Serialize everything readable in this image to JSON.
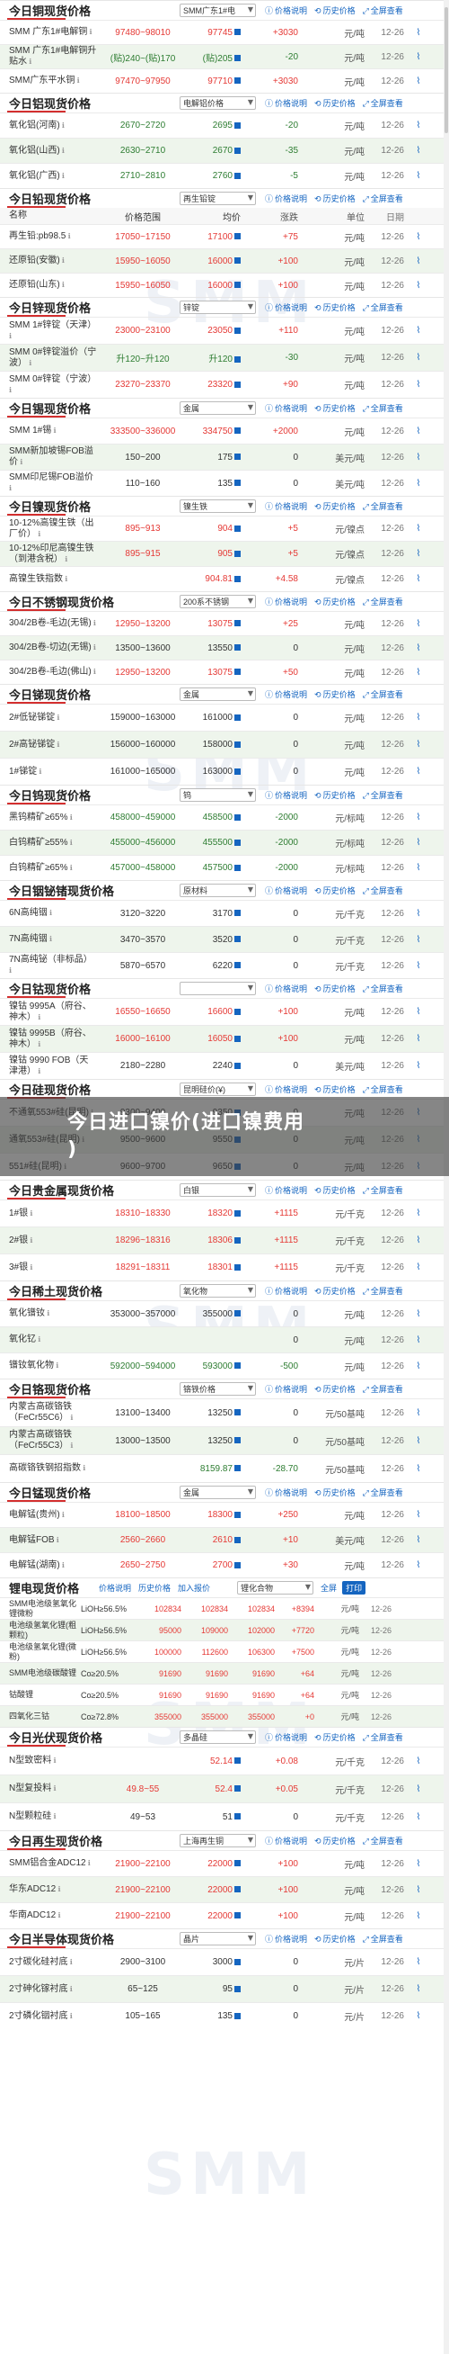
{
  "overlay": {
    "line1": "今日进口镍价(进口镍费用",
    "line2": ")"
  },
  "watermark": "SMM",
  "sections": [
    {
      "key": "copper",
      "title": "今日铜现货价格",
      "select": "SMM广东1#电",
      "links": [
        "价格说明",
        "历史价格",
        "全屏查看"
      ],
      "dateHdr": "",
      "rows": [
        {
          "name": "SMM 广东1#电解铜",
          "range": "97480~98010",
          "avg": "97745",
          "chg": "+3030",
          "cls": "red",
          "unit": "元/吨",
          "date": "12-26"
        },
        {
          "name": "SMM 广东1#电解铜升贴水",
          "range": "(贴)240~(贴)170",
          "avg": "(贴)205",
          "chg": "-20",
          "cls": "green",
          "unit": "元/吨",
          "date": "12-26"
        },
        {
          "name": "SMM广东平水铜",
          "range": "97470~97950",
          "avg": "97710",
          "chg": "+3030",
          "cls": "red",
          "unit": "元/吨",
          "date": "12-26"
        }
      ]
    },
    {
      "key": "alu",
      "title": "今日铝现货价格",
      "select": "电解铝价格",
      "links": [
        "价格说明",
        "历史价格",
        "全屏查看"
      ],
      "rows": [
        {
          "name": "氧化铝(河南)",
          "range": "2670~2720",
          "avg": "2695",
          "chg": "-20",
          "cls": "green",
          "unit": "元/吨",
          "date": "12-26"
        },
        {
          "name": "氧化铝(山西)",
          "range": "2630~2710",
          "avg": "2670",
          "chg": "-35",
          "cls": "green",
          "unit": "元/吨",
          "date": "12-26"
        },
        {
          "name": "氧化铝(广西)",
          "range": "2710~2810",
          "avg": "2760",
          "chg": "-5",
          "cls": "green",
          "unit": "元/吨",
          "date": "12-26"
        }
      ]
    },
    {
      "key": "lead",
      "title": "今日铅现货价格",
      "select": "再生铅锭",
      "links": [
        "价格说明",
        "历史价格",
        "全屏查看"
      ],
      "cols": [
        "名称",
        "价格范围",
        "均价",
        "涨跌",
        "单位",
        "日期"
      ],
      "rows": [
        {
          "name": "再生铅:pb98.5",
          "range": "17050~17150",
          "avg": "17100",
          "chg": "+75",
          "cls": "red",
          "unit": "元/吨",
          "date": "12-26"
        },
        {
          "name": "还原铅(安徽)",
          "range": "15950~16050",
          "avg": "16000",
          "chg": "+100",
          "cls": "red",
          "unit": "元/吨",
          "date": "12-26"
        },
        {
          "name": "还原铅(山东)",
          "range": "15950~16050",
          "avg": "16000",
          "chg": "+100",
          "cls": "red",
          "unit": "元/吨",
          "date": "12-26"
        }
      ]
    },
    {
      "key": "zinc",
      "title": "今日锌现货价格",
      "select": "锌锭",
      "links": [
        "价格说明",
        "历史价格",
        "全屏查看"
      ],
      "rows": [
        {
          "name": "SMM 1#锌锭（天津）",
          "range": "23000~23100",
          "avg": "23050",
          "chg": "+110",
          "cls": "red",
          "unit": "元/吨",
          "date": "12-26"
        },
        {
          "name": "SMM 0#锌锭溢价（宁波）",
          "range": "升120~升120",
          "avg": "升120",
          "chg": "-30",
          "cls": "green",
          "unit": "元/吨",
          "date": "12-26"
        },
        {
          "name": "SMM 0#锌锭（宁波）",
          "range": "23270~23370",
          "avg": "23320",
          "chg": "+90",
          "cls": "red",
          "unit": "元/吨",
          "date": "12-26"
        }
      ]
    },
    {
      "key": "tin",
      "title": "今日锡现货价格",
      "select": "金属",
      "links": [
        "价格说明",
        "历史价格",
        "全屏查看"
      ],
      "rows": [
        {
          "name": "SMM 1#锡",
          "range": "333500~336000",
          "avg": "334750",
          "chg": "+2000",
          "cls": "red",
          "unit": "元/吨",
          "date": "12-26"
        },
        {
          "name": "SMM新加坡锡FOB溢价",
          "range": "150~200",
          "avg": "175",
          "chg": "0",
          "cls": "",
          "unit": "美元/吨",
          "date": "12-26"
        },
        {
          "name": "SMM印尼锡FOB溢价",
          "range": "110~160",
          "avg": "135",
          "chg": "0",
          "cls": "",
          "unit": "美元/吨",
          "date": "12-26"
        }
      ]
    },
    {
      "key": "iron",
      "title": "今日镍现货价格",
      "select": "镍生铁",
      "links": [
        "价格说明",
        "历史价格",
        "全屏查看"
      ],
      "rows": [
        {
          "name": "10-12%高镍生铁（出厂价）",
          "range": "895~913",
          "avg": "904",
          "chg": "+5",
          "cls": "red",
          "unit": "元/镍点",
          "date": "12-26"
        },
        {
          "name": "10-12%印尼高镍生铁（到港含税）",
          "range": "895~915",
          "avg": "905",
          "chg": "+5",
          "cls": "red",
          "unit": "元/镍点",
          "date": "12-26"
        },
        {
          "name": "高镍生铁指数",
          "range": "",
          "avg": "904.81",
          "chg": "+4.58",
          "cls": "red",
          "unit": "元/镍点",
          "date": "12-26"
        }
      ]
    },
    {
      "key": "ss",
      "title": "今日不锈钢现货价格",
      "select": "200系不锈钢",
      "links": [
        "价格说明",
        "历史价格",
        "全屏查看"
      ],
      "rows": [
        {
          "name": "304/2B卷-毛边(无锡)",
          "range": "12950~13200",
          "avg": "13075",
          "chg": "+25",
          "cls": "red",
          "unit": "元/吨",
          "date": "12-26"
        },
        {
          "name": "304/2B卷-切边(无锡)",
          "range": "13500~13600",
          "avg": "13550",
          "chg": "0",
          "cls": "",
          "unit": "元/吨",
          "date": "12-26"
        },
        {
          "name": "304/2B卷-毛边(佛山)",
          "range": "12950~13200",
          "avg": "13075",
          "chg": "+50",
          "cls": "red",
          "unit": "元/吨",
          "date": "12-26"
        }
      ]
    },
    {
      "key": "anti",
      "title": "今日锑现货价格",
      "select": "金属",
      "links": [
        "价格说明",
        "历史价格",
        "全屏查看"
      ],
      "rows": [
        {
          "name": "2#低铋锑锭",
          "range": "159000~163000",
          "avg": "161000",
          "chg": "0",
          "cls": "",
          "unit": "元/吨",
          "date": "12-26"
        },
        {
          "name": "2#高铋锑锭",
          "range": "156000~160000",
          "avg": "158000",
          "chg": "0",
          "cls": "",
          "unit": "元/吨",
          "date": "12-26"
        },
        {
          "name": "1#锑锭",
          "range": "161000~165000",
          "avg": "163000",
          "chg": "0",
          "cls": "",
          "unit": "元/吨",
          "date": "12-26"
        }
      ]
    },
    {
      "key": "w",
      "title": "今日钨现货价格",
      "select": "钨",
      "links": [
        "价格说明",
        "历史价格",
        "全屏查看"
      ],
      "rows": [
        {
          "name": "黑钨精矿≥65%",
          "range": "458000~459000",
          "avg": "458500",
          "chg": "-2000",
          "cls": "green",
          "unit": "元/标吨",
          "date": "12-26"
        },
        {
          "name": "白钨精矿≥55%",
          "range": "455000~456000",
          "avg": "455500",
          "chg": "-2000",
          "cls": "green",
          "unit": "元/标吨",
          "date": "12-26"
        },
        {
          "name": "白钨精矿≥65%",
          "range": "457000~458000",
          "avg": "457500",
          "chg": "-2000",
          "cls": "green",
          "unit": "元/标吨",
          "date": "12-26"
        }
      ]
    },
    {
      "key": "in",
      "title": "今日铟铋锗现货价格",
      "select": "原材料",
      "links": [
        "价格说明",
        "历史价格",
        "全屏查看"
      ],
      "rows": [
        {
          "name": "6N高纯铟",
          "range": "3120~3220",
          "avg": "3170",
          "chg": "0",
          "cls": "",
          "unit": "元/千克",
          "date": "12-26"
        },
        {
          "name": "7N高纯铟",
          "range": "3470~3570",
          "avg": "3520",
          "chg": "0",
          "cls": "",
          "unit": "元/千克",
          "date": "12-26"
        },
        {
          "name": "7N高纯铋（非标品）",
          "range": "5870~6570",
          "avg": "6220",
          "chg": "0",
          "cls": "",
          "unit": "元/千克",
          "date": "12-26"
        }
      ]
    },
    {
      "key": "co",
      "title": "今日钴现货价格",
      "select": "",
      "links": [
        "价格说明",
        "历史价格",
        "全屏查看"
      ],
      "rows": [
        {
          "name": "镍钴 9995A（府谷、神木）",
          "range": "16550~16650",
          "avg": "16600",
          "chg": "+100",
          "cls": "red",
          "unit": "元/吨",
          "date": "12-26"
        },
        {
          "name": "镍钴 9995B（府谷、神木）",
          "range": "16000~16100",
          "avg": "16050",
          "chg": "+100",
          "cls": "red",
          "unit": "元/吨",
          "date": "12-26"
        },
        {
          "name": "镍钴 9990 FOB（天津港）",
          "range": "2180~2280",
          "avg": "2240",
          "chg": "0",
          "cls": "",
          "unit": "美元/吨",
          "date": "12-26"
        }
      ]
    },
    {
      "key": "si",
      "title": "今日硅现货价格",
      "select": "昆明硅价(¥)",
      "links": [
        "价格说明",
        "历史价格",
        "全屏查看"
      ],
      "rows": [
        {
          "name": "不通氧553#硅(昆明)",
          "range": "9300~9400",
          "avg": "9350",
          "chg": "0",
          "cls": "",
          "unit": "元/吨",
          "date": "12-26"
        },
        {
          "name": "通氧553#硅(昆明)",
          "range": "9500~9600",
          "avg": "9550",
          "chg": "0",
          "cls": "",
          "unit": "元/吨",
          "date": "12-26"
        },
        {
          "name": "551#硅(昆明)",
          "range": "9600~9700",
          "avg": "9650",
          "chg": "0",
          "cls": "",
          "unit": "元/吨",
          "date": "12-26"
        }
      ]
    },
    {
      "key": "ag",
      "title": "今日贵金属现货价格",
      "select": "白银",
      "links": [
        "价格说明",
        "历史价格",
        "全屏查看"
      ],
      "rows": [
        {
          "name": "1#银",
          "range": "18310~18330",
          "avg": "18320",
          "chg": "+1115",
          "cls": "red",
          "unit": "元/千克",
          "date": "12-26"
        },
        {
          "name": "2#银",
          "range": "18296~18316",
          "avg": "18306",
          "chg": "+1115",
          "cls": "red",
          "unit": "元/千克",
          "date": "12-26"
        },
        {
          "name": "3#银",
          "range": "18291~18311",
          "avg": "18301",
          "chg": "+1115",
          "cls": "red",
          "unit": "元/千克",
          "date": "12-26"
        }
      ]
    },
    {
      "key": "re",
      "title": "今日稀土现货价格",
      "select": "氧化物",
      "links": [
        "价格说明",
        "历史价格",
        "全屏查看"
      ],
      "rows": [
        {
          "name": "氧化镨钕",
          "range": "353000~357000",
          "avg": "355000",
          "chg": "0",
          "cls": "",
          "unit": "元/吨",
          "date": "12-26"
        },
        {
          "name": "氧化钇",
          "range": "",
          "avg": "",
          "chg": "0",
          "cls": "",
          "unit": "元/吨",
          "date": "12-26"
        },
        {
          "name": "镨钕氧化物",
          "range": "592000~594000",
          "avg": "593000",
          "chg": "-500",
          "cls": "green",
          "unit": "元/吨",
          "date": "12-26"
        }
      ]
    },
    {
      "key": "fe",
      "title": "今日铬现货价格",
      "select": "铬铁价格",
      "links": [
        "价格说明",
        "历史价格",
        "全屏查看"
      ],
      "rows": [
        {
          "name": "内蒙古高碳铬铁（FeCr55C6）",
          "range": "13100~13400",
          "avg": "13250",
          "chg": "0",
          "cls": "",
          "unit": "元/50基吨",
          "date": "12-26"
        },
        {
          "name": "内蒙古高碳铬铁（FeCr55C3）",
          "range": "13000~13500",
          "avg": "13250",
          "chg": "0",
          "cls": "",
          "unit": "元/50基吨",
          "date": "12-26"
        },
        {
          "name": "高碳铬铁钢招指数",
          "range": "",
          "avg": "8159.87",
          "chg": "-28.70",
          "cls": "green",
          "unit": "元/50基吨",
          "date": "12-26"
        }
      ]
    },
    {
      "key": "mn",
      "title": "今日锰现货价格",
      "select": "金属",
      "links": [
        "价格说明",
        "历史价格",
        "全屏查看"
      ],
      "rows": [
        {
          "name": "电解锰(贵州)",
          "range": "18100~18500",
          "avg": "18300",
          "chg": "+250",
          "cls": "red",
          "unit": "元/吨",
          "date": "12-26"
        },
        {
          "name": "电解锰FOB",
          "range": "2560~2660",
          "avg": "2610",
          "chg": "+10",
          "cls": "red",
          "unit": "美元/吨",
          "date": "12-26"
        },
        {
          "name": "电解锰(湖南)",
          "range": "2650~2750",
          "avg": "2700",
          "chg": "+30",
          "cls": "red",
          "unit": "元/吨",
          "date": "12-26"
        }
      ]
    }
  ],
  "lithium": {
    "title": "锂电现货价格",
    "links": [
      "价格说明",
      "历史价格",
      "加入报价"
    ],
    "select": "锂化合物",
    "btn": "全屏",
    "print": "打印",
    "rows": [
      {
        "name": "SMM电池级氢氧化锂微粉",
        "spec": "LiOH≥56.5%",
        "v1": "102834",
        "v2": "102834",
        "v3": "102834",
        "chg": "+8394",
        "unit": "元/吨",
        "date": "12-26"
      },
      {
        "name": "电池级氢氧化锂(粗颗粒)",
        "spec": "LiOH≥56.5%",
        "v1": "95000",
        "v2": "109000",
        "v3": "102000",
        "chg": "+7720",
        "unit": "元/吨",
        "date": "12-26"
      },
      {
        "name": "电池级氢氧化锂(微粉)",
        "spec": "LiOH≥56.5%",
        "v1": "100000",
        "v2": "112600",
        "v3": "106300",
        "chg": "+7500",
        "unit": "元/吨",
        "date": "12-26"
      },
      {
        "name": "SMM电池级碳酸锂",
        "spec": "Co≥20.5%",
        "v1": "91690",
        "v2": "91690",
        "v3": "91690",
        "chg": "+64",
        "unit": "元/吨",
        "date": "12-26"
      },
      {
        "name": "钴酸锂",
        "spec": "Co≥20.5%",
        "v1": "91690",
        "v2": "91690",
        "v3": "91690",
        "chg": "+64",
        "unit": "元/吨",
        "date": "12-26"
      },
      {
        "name": "四氧化三钴",
        "spec": "Co≥72.8%",
        "v1": "355000",
        "v2": "355000",
        "v3": "355000",
        "chg": "+0",
        "unit": "元/吨",
        "date": "12-26"
      }
    ]
  },
  "tail": [
    {
      "key": "pv",
      "title": "今日光伏现货价格",
      "select": "多晶硅",
      "links": [
        "价格说明",
        "历史价格",
        "全屏查看"
      ],
      "rows": [
        {
          "name": "N型致密料",
          "range": "",
          "avg": "52.14",
          "chg": "+0.08",
          "cls": "red",
          "unit": "元/千克",
          "date": "12-26"
        },
        {
          "name": "N型复投料",
          "range": "49.8~55",
          "avg": "52.4",
          "chg": "+0.05",
          "cls": "red",
          "unit": "元/千克",
          "date": "12-26"
        },
        {
          "name": "N型颗粒硅",
          "range": "49~53",
          "avg": "51",
          "chg": "0",
          "cls": "",
          "unit": "元/千克",
          "date": "12-26"
        }
      ]
    },
    {
      "key": "rc",
      "title": "今日再生现货价格",
      "select": "上海再生铜",
      "links": [
        "价格说明",
        "历史价格",
        "全屏查看"
      ],
      "rows": [
        {
          "name": "SMM铝合金ADC12",
          "range": "21900~22100",
          "avg": "22000",
          "chg": "+100",
          "cls": "red",
          "unit": "元/吨",
          "date": "12-26"
        },
        {
          "name": "华东ADC12",
          "range": "21900~22100",
          "avg": "22000",
          "chg": "+100",
          "cls": "red",
          "unit": "元/吨",
          "date": "12-26"
        },
        {
          "name": "华南ADC12",
          "range": "21900~22100",
          "avg": "22000",
          "chg": "+100",
          "cls": "red",
          "unit": "元/吨",
          "date": "12-26"
        }
      ]
    },
    {
      "key": "semi",
      "title": "今日半导体现货价格",
      "select": "晶片",
      "links": [
        "价格说明",
        "历史价格",
        "全屏查看"
      ],
      "rows": [
        {
          "name": "2寸碳化硅衬底",
          "range": "2900~3100",
          "avg": "3000",
          "chg": "0",
          "cls": "",
          "unit": "元/片",
          "date": "12-26"
        },
        {
          "name": "2寸砷化镓衬底",
          "range": "65~125",
          "avg": "95",
          "chg": "0",
          "cls": "",
          "unit": "元/片",
          "date": "12-26"
        },
        {
          "name": "2寸磷化铟衬底",
          "range": "105~165",
          "avg": "135",
          "chg": "0",
          "cls": "",
          "unit": "元/片",
          "date": "12-26"
        }
      ]
    }
  ]
}
